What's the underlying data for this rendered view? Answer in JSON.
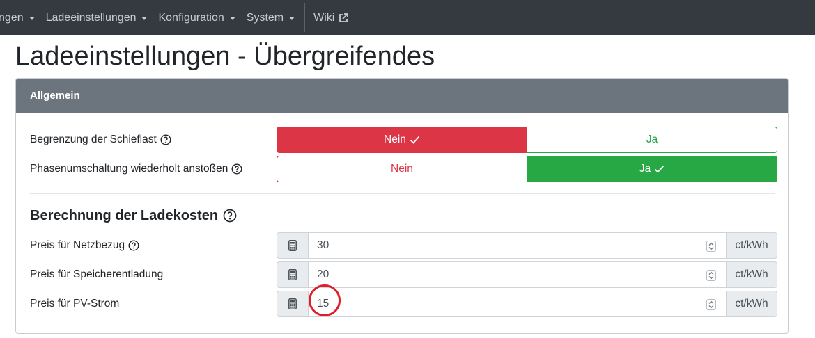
{
  "nav": {
    "items": [
      {
        "label": "ngen"
      },
      {
        "label": "Ladeeinstellungen"
      },
      {
        "label": "Konfiguration"
      },
      {
        "label": "System"
      }
    ],
    "wiki_label": "Wiki"
  },
  "page": {
    "title": "Ladeeinstellungen - Übergreifendes"
  },
  "card": {
    "header": "Allgemein",
    "rows": [
      {
        "label": "Begrenzung der Schieflast",
        "no": "Nein",
        "yes": "Ja",
        "selected": "Nein"
      },
      {
        "label": "Phasenumschaltung wiederholt anstoßen",
        "no": "Nein",
        "yes": "Ja",
        "selected": "Ja"
      }
    ],
    "cost_section": {
      "title": "Berechnung der Ladekosten",
      "fields": [
        {
          "label": "Preis für Netzbezug",
          "value": "30",
          "unit": "ct/kWh"
        },
        {
          "label": "Preis für Speicherentladung",
          "value": "20",
          "unit": "ct/kWh"
        },
        {
          "label": "Preis für PV-Strom",
          "value": "15",
          "unit": "ct/kWh"
        }
      ]
    }
  },
  "colors": {
    "navbar": "#343a40",
    "danger": "#dc3545",
    "success": "#28a745",
    "card_header": "#6c757d",
    "annotation": "#e01e2b"
  },
  "icons": [
    "caret-down-icon",
    "external-link-icon",
    "help-circle-icon",
    "check-icon",
    "calculator-icon",
    "spinner-arrows-icon"
  ]
}
